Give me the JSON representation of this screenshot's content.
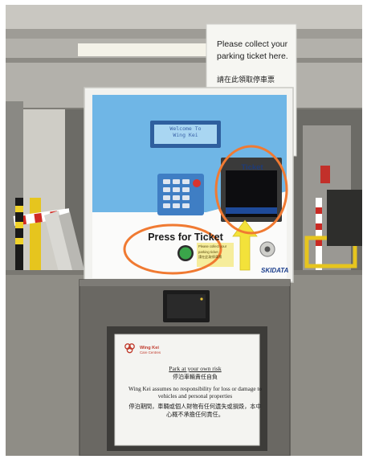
{
  "screen": {
    "line1": "Welcome To",
    "line2": "Wing Kei"
  },
  "machine": {
    "press_label": "Press for Ticket",
    "ticket_label": "Ticket",
    "brand": "SKIDATA",
    "sticker_line1": "Please collect your",
    "sticker_line2": "parking ticket",
    "sticker_line3": "請在此取停車票"
  },
  "sign": {
    "line1": "Please collect your",
    "line2": "parking ticket here.",
    "line3": "請在此領取停車票"
  },
  "notice": {
    "logo_line1": "Wing Kei",
    "logo_line2": "Care Centres",
    "title": "Park at your own risk",
    "title_zh": "停泊車輛責任自負",
    "body_en": "Wing Kei assumes no responsibility for loss or damage to vehicles and personal properties",
    "body_zh": "停泊期間，車輛或個人財物有任何遺失或損毀，本中心概不承擔任何責任。"
  },
  "colors": {
    "highlight_circle": "#f07a32",
    "arrow_yellow": "#f3e23a",
    "panel_blue": "#6fb6e6"
  }
}
